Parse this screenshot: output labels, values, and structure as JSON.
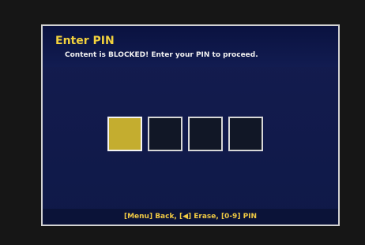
{
  "dialog": {
    "title": "Enter PIN",
    "message": "Content is BLOCKED!  Enter your PIN to proceed.",
    "footer_hint": "[Menu] Back, [◀] Erase, [0-9] PIN"
  },
  "pin_entry": {
    "slots": 4,
    "active_slot": 1
  },
  "colors": {
    "title": "#f2d13d",
    "dialog_bg": "#101a4a",
    "border": "#d2d2d2",
    "active_slot": "#c4ad2f",
    "inactive_slot": "#111726",
    "footer_text": "#efc943"
  }
}
